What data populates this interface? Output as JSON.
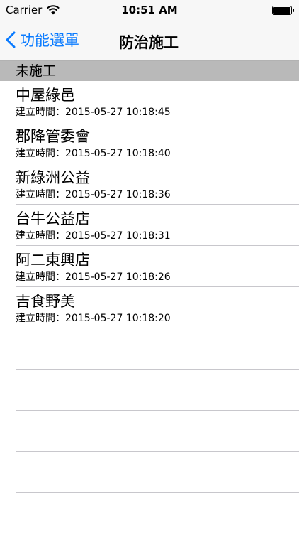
{
  "status_bar": {
    "carrier": "Carrier",
    "time": "10:51 AM",
    "battery_level": 1.0
  },
  "nav": {
    "back_label": "功能選單",
    "title": "防治施工"
  },
  "section": {
    "header": "未施工"
  },
  "items": [
    {
      "title": "中屋綠邑",
      "created": "建立時間：2015-05-27 10:18:45"
    },
    {
      "title": "郡降管委會",
      "created": "建立時間：2015-05-27 10:18:40"
    },
    {
      "title": "新綠洲公益",
      "created": "建立時間：2015-05-27 10:18:36"
    },
    {
      "title": "台牛公益店",
      "created": "建立時間：2015-05-27 10:18:31"
    },
    {
      "title": "阿二東興店",
      "created": "建立時間：2015-05-27 10:18:26"
    },
    {
      "title": "吉食野美",
      "created": "建立時間：2015-05-27 10:18:20"
    }
  ],
  "colors": {
    "accent": "#0a7bff",
    "section_bg": "#b9b9b9",
    "separator": "#c8c7cc"
  }
}
